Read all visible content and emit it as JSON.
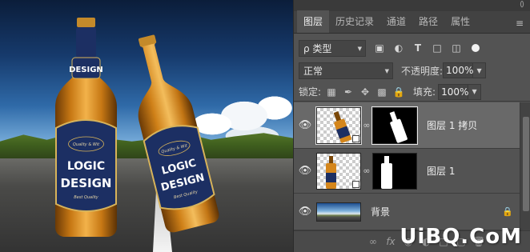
{
  "tabs": [
    {
      "label": "图层",
      "active": true
    },
    {
      "label": "历史记录",
      "active": false
    },
    {
      "label": "通道",
      "active": false
    },
    {
      "label": "路径",
      "active": false
    },
    {
      "label": "属性",
      "active": false
    }
  ],
  "filter": {
    "kind_label": "ρ 类型"
  },
  "blend": {
    "mode": "正常",
    "opacity_label": "不透明度:",
    "opacity_value": "100%"
  },
  "lock": {
    "label": "锁定:",
    "fill_label": "填充:",
    "fill_value": "100%"
  },
  "layers": [
    {
      "name": "图层 1 拷贝",
      "selected": true,
      "visible": true
    },
    {
      "name": "图层 1",
      "selected": false,
      "visible": true
    },
    {
      "name": "背景",
      "selected": false,
      "visible": true,
      "locked": true
    }
  ],
  "bottle_label": {
    "line1": "DESIGN",
    "logo_top": "LOGIC",
    "logo_bottom": "DESIGN",
    "script": "Quality & Wit",
    "small": "Best Quality"
  },
  "watermark": "UiBQ.CoM",
  "colors": {
    "panel_bg": "#535353",
    "selected_layer": "#696969",
    "tab_bar": "#424242",
    "label_navy": "#1c2f63"
  }
}
